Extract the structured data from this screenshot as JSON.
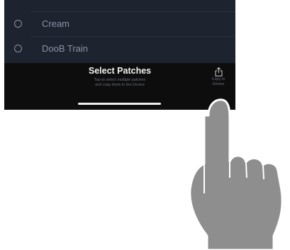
{
  "list": {
    "items": [
      {
        "label": "Cream"
      },
      {
        "label": "DooB Train"
      }
    ]
  },
  "bottom_bar": {
    "title": "Select Patches",
    "subtitle_line1": "Tap to select multiple patches",
    "subtitle_line2": "and copy them to the Device",
    "copy_label_line1": "Copy to",
    "copy_label_line2": "Device"
  },
  "icons": {
    "share": "share-upload-icon",
    "radio": "radio-empty-icon",
    "hand": "pointing-hand-icon"
  },
  "colors": {
    "list_bg": "#1e2330",
    "bar_bg": "#0d0d0e",
    "text_dim": "#8b92a3",
    "hand": "#8e8e8e"
  }
}
